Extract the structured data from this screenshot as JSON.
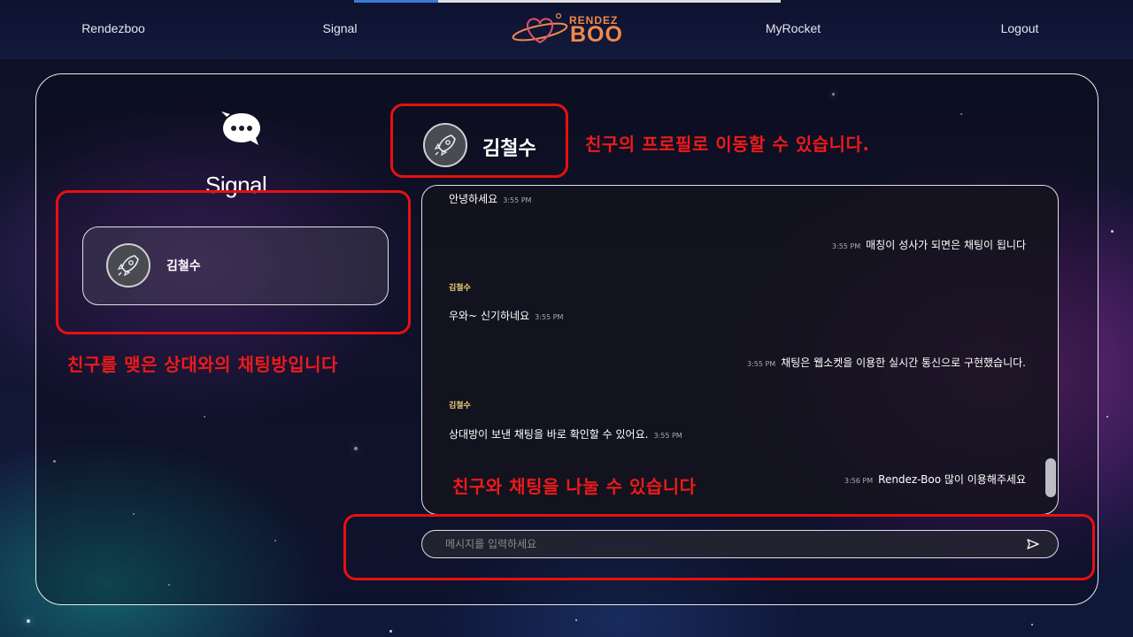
{
  "nav": {
    "items": [
      "Rendezboo",
      "Signal",
      "MyRocket",
      "Logout"
    ],
    "logo_top": "RENDEZ",
    "logo_bottom": "BOO"
  },
  "sidebar": {
    "title": "Signal",
    "friends": [
      {
        "name": "김철수"
      }
    ]
  },
  "chat": {
    "header_name": "김철수",
    "messages": [
      {
        "side": "left",
        "sender": "",
        "text": "안녕하세요",
        "time": "3:55 PM"
      },
      {
        "side": "right",
        "sender": "",
        "text": "매칭이 성사가 되면은 채팅이 됩니다",
        "time": "3:55 PM"
      },
      {
        "side": "left",
        "sender": "김철수",
        "text": "우와~ 신기하네요",
        "time": "3:55 PM"
      },
      {
        "side": "right",
        "sender": "",
        "text": "채팅은 웹소켓을 이용한 실시간 통신으로 구현했습니다.",
        "time": "3:55 PM"
      },
      {
        "side": "left",
        "sender": "김철수",
        "text": "상대방이 보낸 채팅을 바로 확인할 수 있어요.",
        "time": "3:55 PM"
      },
      {
        "side": "right",
        "sender": "",
        "text": "Rendez-Boo 많이 이용해주세요",
        "time": "3:56 PM"
      }
    ],
    "input_placeholder": "메시지를 입력하세요"
  },
  "annotations": {
    "profile": "친구의 프로필로 이동할 수 있습니다.",
    "rooms": "친구를 맺은 상대와의 채팅방입니다",
    "chat": "친구와 채팅을 나눌 수 있습니다"
  },
  "colors": {
    "annotation_red": "#e81010",
    "logo_orange": "#f08a4b",
    "sender_yellow": "#f2d27a"
  }
}
